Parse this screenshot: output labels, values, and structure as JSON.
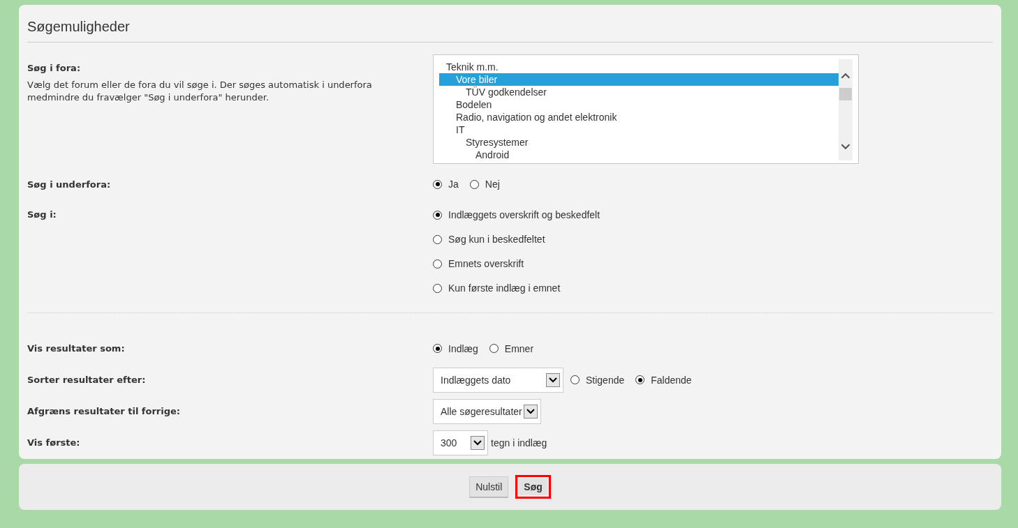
{
  "heading": "Søgemuligheder",
  "forum_filter": {
    "label": "Søg i fora:",
    "description": "Vælg det forum eller de fora du vil søge i. Der søges automatisk i underfora medmindre du fravælger \"Søg i underfora\" herunder.",
    "forums": [
      {
        "name": "Teknik m.m.",
        "selected": false,
        "children": [
          {
            "name": "Vore biler",
            "selected": true,
            "children": [
              {
                "name": "TÜV godkendelser",
                "selected": false
              }
            ]
          },
          {
            "name": "Bodelen",
            "selected": false
          },
          {
            "name": "Radio, navigation og andet elektronik",
            "selected": false
          },
          {
            "name": "IT",
            "selected": false,
            "children": [
              {
                "name": "Styresystemer",
                "selected": false,
                "children": [
                  {
                    "name": "Android",
                    "selected": false
                  }
                ]
              }
            ]
          }
        ]
      }
    ]
  },
  "subforums": {
    "label": "Søg i underfora:",
    "options": [
      {
        "label": "Ja",
        "selected": true
      },
      {
        "label": "Nej",
        "selected": false
      }
    ]
  },
  "search_in": {
    "label": "Søg i:",
    "options": [
      {
        "label": "Indlæggets overskrift og beskedfelt",
        "selected": true
      },
      {
        "label": "Søg kun i beskedfeltet",
        "selected": false
      },
      {
        "label": "Emnets overskrift",
        "selected": false
      },
      {
        "label": "Kun første indlæg i emnet",
        "selected": false
      }
    ]
  },
  "display": {
    "label": "Vis resultater som:",
    "options": [
      {
        "label": "Indlæg",
        "selected": true
      },
      {
        "label": "Emner",
        "selected": false
      }
    ]
  },
  "sort": {
    "label": "Sorter resultater efter:",
    "select": "Indlæggets dato",
    "options": [
      {
        "label": "Stigende",
        "selected": false
      },
      {
        "label": "Faldende",
        "selected": true
      }
    ]
  },
  "limit": {
    "label": "Afgræns resultater til forrige:",
    "select": "Alle søgeresultater"
  },
  "show_first": {
    "label": "Vis første:",
    "select": "300",
    "suffix": "tegn i indlæg"
  },
  "buttons": [
    {
      "label": "Nulstil",
      "highlighted": false
    },
    {
      "label": "Søg",
      "highlighted": true
    }
  ]
}
